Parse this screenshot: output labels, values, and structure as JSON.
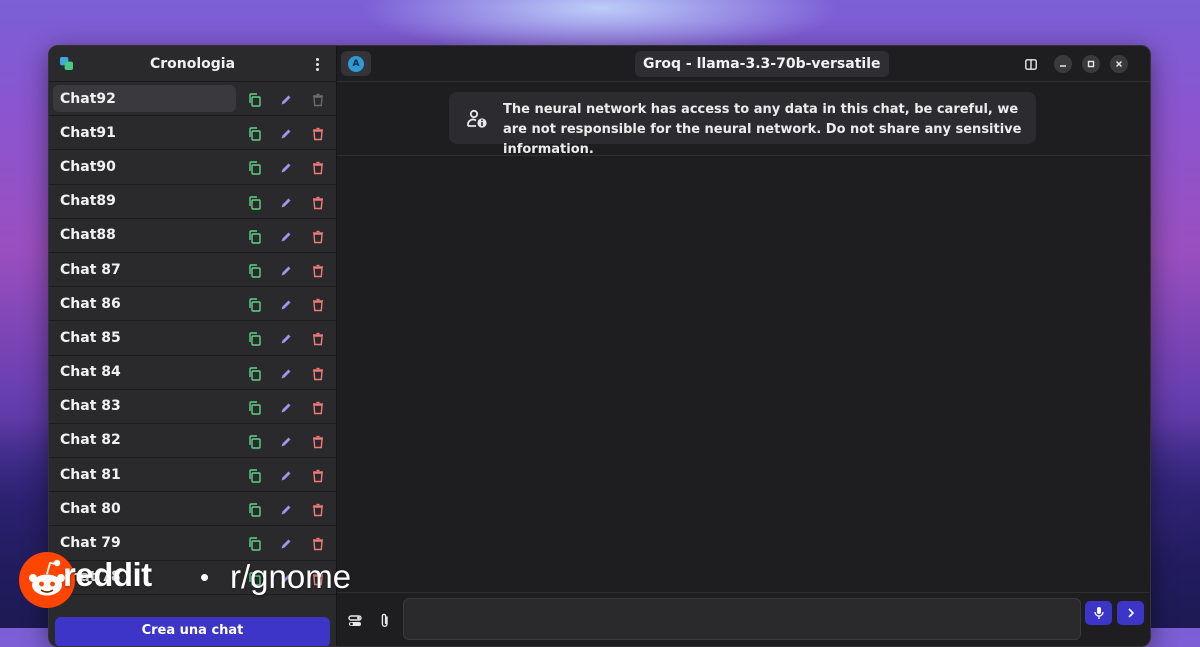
{
  "sidebar": {
    "title": "Cronologia",
    "menu_icon": "kebab-menu-icon",
    "items": [
      {
        "label": "Chat92",
        "active": true
      },
      {
        "label": "Chat91"
      },
      {
        "label": "Chat90"
      },
      {
        "label": "Chat89"
      },
      {
        "label": "Chat88"
      },
      {
        "label": "Chat 87"
      },
      {
        "label": "Chat 86"
      },
      {
        "label": "Chat 85"
      },
      {
        "label": "Chat 84"
      },
      {
        "label": "Chat 83"
      },
      {
        "label": "Chat 82"
      },
      {
        "label": "Chat 81"
      },
      {
        "label": "Chat 80"
      },
      {
        "label": "Chat 79"
      },
      {
        "label": "Chat 78"
      }
    ],
    "new_chat_label": "Crea una chat"
  },
  "header": {
    "avatar_letter": "A",
    "model_title": "Groq - llama-3.3-70b-versatile"
  },
  "notice": {
    "text": "The neural network has access to any data in this chat, be careful, we are not responsible for the neural network. Do not share any sensitive information."
  },
  "watermark": {
    "brand": "reddit",
    "separator": "•",
    "subreddit": "r/gnome"
  },
  "colors": {
    "accent": "#3c35c8",
    "copy_icon": "#5fd38a",
    "edit_icon": "#9e97f0",
    "delete_icon": "#f07a7a",
    "reddit_orange": "#ff4500"
  }
}
